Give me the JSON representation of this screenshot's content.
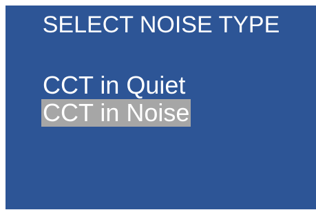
{
  "screen": {
    "title": "SELECT NOISE TYPE",
    "background_color": "#2d5596",
    "highlight_color": "#a6a6a6",
    "text_color": "#ffffff"
  },
  "menu": {
    "items": [
      {
        "label": "CCT in Quiet",
        "selected": false
      },
      {
        "label": "CCT in Noise",
        "selected": true
      }
    ]
  }
}
